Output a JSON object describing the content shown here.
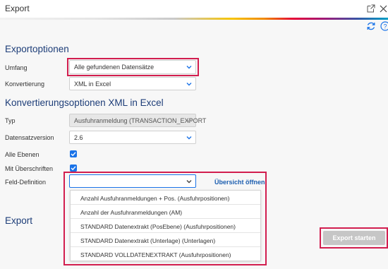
{
  "window": {
    "title": "Export"
  },
  "sections": {
    "export_options": "Exportoptionen",
    "conversion_options": "Konvertierungsoptionen XML in Excel",
    "export": "Export"
  },
  "fields": {
    "umfang": {
      "label": "Umfang",
      "value": "Alle gefundenen Datensätze"
    },
    "konvertierung": {
      "label": "Konvertierung",
      "value": "XML in Excel"
    },
    "typ": {
      "label": "Typ",
      "value": "Ausfuhranmeldung (TRANSACTION_EXPORT"
    },
    "datensatzversion": {
      "label": "Datensatzversion",
      "value": "2.6"
    },
    "alle_ebenen": {
      "label": "Alle Ebenen",
      "checked": true
    },
    "mit_ueberschriften": {
      "label": "Mit Überschriften",
      "checked": true
    },
    "feld_definition": {
      "label": "Feld-Definition",
      "value": "",
      "link": "Übersicht öffnen"
    }
  },
  "dropdown_options": [
    "Anzahl Ausfuhranmeldungen + Pos. (Ausfuhrpositionen)",
    "Anzahl der Ausfuhranmeldungen (AM)",
    "STANDARD Datenextrakt (PosEbene) (Ausfuhrpositionen)",
    "STANDARD Datenextrakt (Unterlage) (Unterlagen)",
    "STANDARD VOLLDATENEXTRAKT (Ausfuhrpositionen)"
  ],
  "buttons": {
    "start_export": "Export starten"
  },
  "icons": [
    "external-link-icon",
    "close-icon",
    "refresh-icon",
    "help-icon",
    "chevron-down-icon",
    "checkmark-icon"
  ],
  "colors": {
    "accent": "#1a73e8",
    "heading": "#1d3d78",
    "highlight": "#d21e4f",
    "button_disabled": "#c6c6c6"
  }
}
